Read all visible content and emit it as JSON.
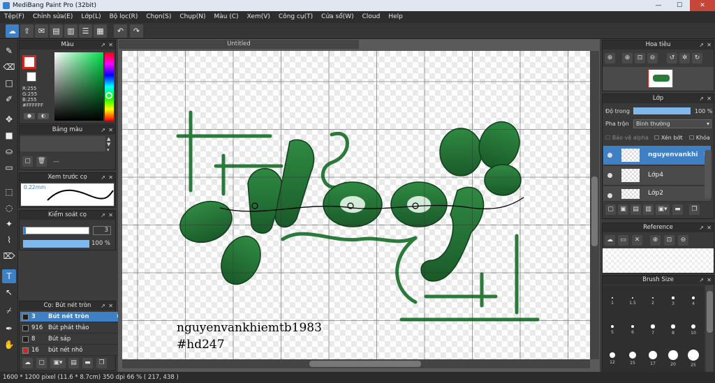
{
  "window": {
    "title": "MediBang Paint Pro (32bit)",
    "minimize": "—",
    "maximize": "☐",
    "close": "✕"
  },
  "menu": [
    "Tệp(F)",
    "Chỉnh sửa(E)",
    "Lớp(L)",
    "Bộ lọc(R)",
    "Chọn(S)",
    "Chụp(N)",
    "Màu (C)",
    "Xem(V)",
    "Công cụ(T)",
    "Cửa sổ(W)",
    "Cloud",
    "Help"
  ],
  "color_panel": {
    "title": "Màu",
    "r": "R:255",
    "g": "G:255",
    "b": "B:255",
    "hex": "#FFFFFF",
    "primary": "#ffffff",
    "accent": "#d8251c"
  },
  "palette_panel": {
    "title": "Bảng màu",
    "none": "---"
  },
  "brush_preview_panel": {
    "title": "Xem trước cọ",
    "size": "0.22mm"
  },
  "brush_control_panel": {
    "title": "Kiểm soát cọ",
    "size_value": "3",
    "opacity_value": "100 %"
  },
  "brush_list_panel": {
    "title": "Cọ: Bút nét tròn",
    "items": [
      {
        "size": "3",
        "name": "Bút nét tròn",
        "color": "#1e1e1e"
      },
      {
        "size": "916",
        "name": "Bút phát thảo",
        "color": "#1e1e1e"
      },
      {
        "size": "8",
        "name": "Bút sáp",
        "color": "#1e1e1e"
      },
      {
        "size": "16",
        "name": "bút nét nhỏ",
        "color": "#d8251c"
      }
    ]
  },
  "document": {
    "tab": "Untitled",
    "watermark_line1": "nguyenvankhiemtb1983",
    "watermark_line2": "#hd247"
  },
  "navigator_panel": {
    "title": "Hoa tiêu"
  },
  "layer_panel": {
    "title": "Lớp",
    "opacity_label": "Độ trong",
    "opacity_value": "100 %",
    "blend_label": "Pha trộn",
    "blend_value": "Bình thường",
    "alpha_label": "Bảo vệ alpha",
    "clip_label": "Xén bớt",
    "lock_label": "Khóa",
    "layers": [
      {
        "name": "nguyenvankhi"
      },
      {
        "name": "Lớp4"
      },
      {
        "name": "Lớp2"
      }
    ]
  },
  "reference_panel": {
    "title": "Reference"
  },
  "brush_size_panel": {
    "title": "Brush Size",
    "sizes": [
      "1",
      "1.5",
      "2",
      "3",
      "4",
      "5",
      "6",
      "7",
      "8",
      "10",
      "12",
      "15",
      "17",
      "20",
      "25"
    ]
  },
  "status": {
    "text": "1600 * 1200 pixel   (11.6 * 8.7cm)  350 dpi  66 %   ( 217, 438 )"
  }
}
